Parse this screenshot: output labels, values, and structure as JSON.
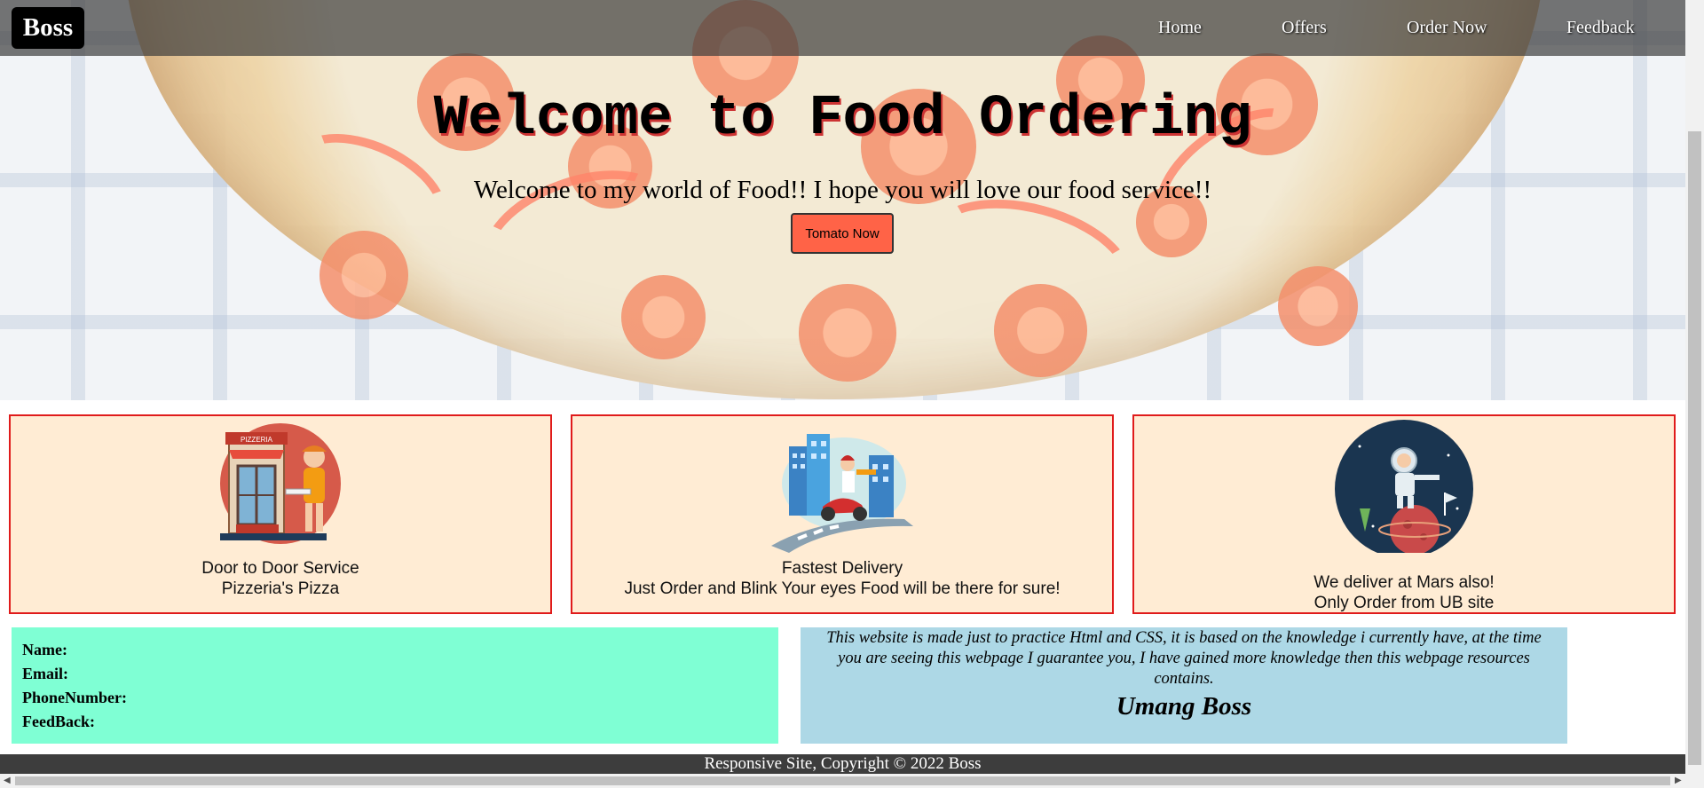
{
  "navbar": {
    "logo": "Boss",
    "links": [
      "Home",
      "Offers",
      "Order Now",
      "Feedback"
    ]
  },
  "hero": {
    "title": "Welcome to Food Ordering",
    "subtitle": "Welcome to my world of Food!! I hope you will love our food service!!",
    "button_label": "Tomato Now"
  },
  "cards": [
    {
      "line1": "Door to Door Service",
      "line2": "Pizzeria's Pizza",
      "illustration": "pizzeria-shop",
      "sign": "PIZZERIA"
    },
    {
      "line1": "Fastest Delivery",
      "line2": "Just Order and Blink Your eyes Food will be there for sure!",
      "illustration": "scooter-delivery"
    },
    {
      "line1": "We deliver at Mars also!",
      "line2": "Only Order from UB site",
      "illustration": "astronaut-mars"
    }
  ],
  "form": {
    "name_label": "Name:",
    "email_label": "Email:",
    "phone_label": "PhoneNumber:",
    "feedback_label": "FeedBack:"
  },
  "info": {
    "text": "This website is made just to practice Html and CSS, it is based on the knowledge i currently have, at the time you are seeing this webpage I guarantee you, I have gained more knowledge then this webpage resources contains.",
    "author": "Umang Boss"
  },
  "footer": {
    "text": "Responsive Site, Copyright © 2022 Boss"
  },
  "colors": {
    "button_bg": "#ff6347",
    "card_bg": "#ffecd4",
    "card_border": "#e01b1b",
    "form_bg": "#7fffd4",
    "info_bg": "#add8e6"
  }
}
